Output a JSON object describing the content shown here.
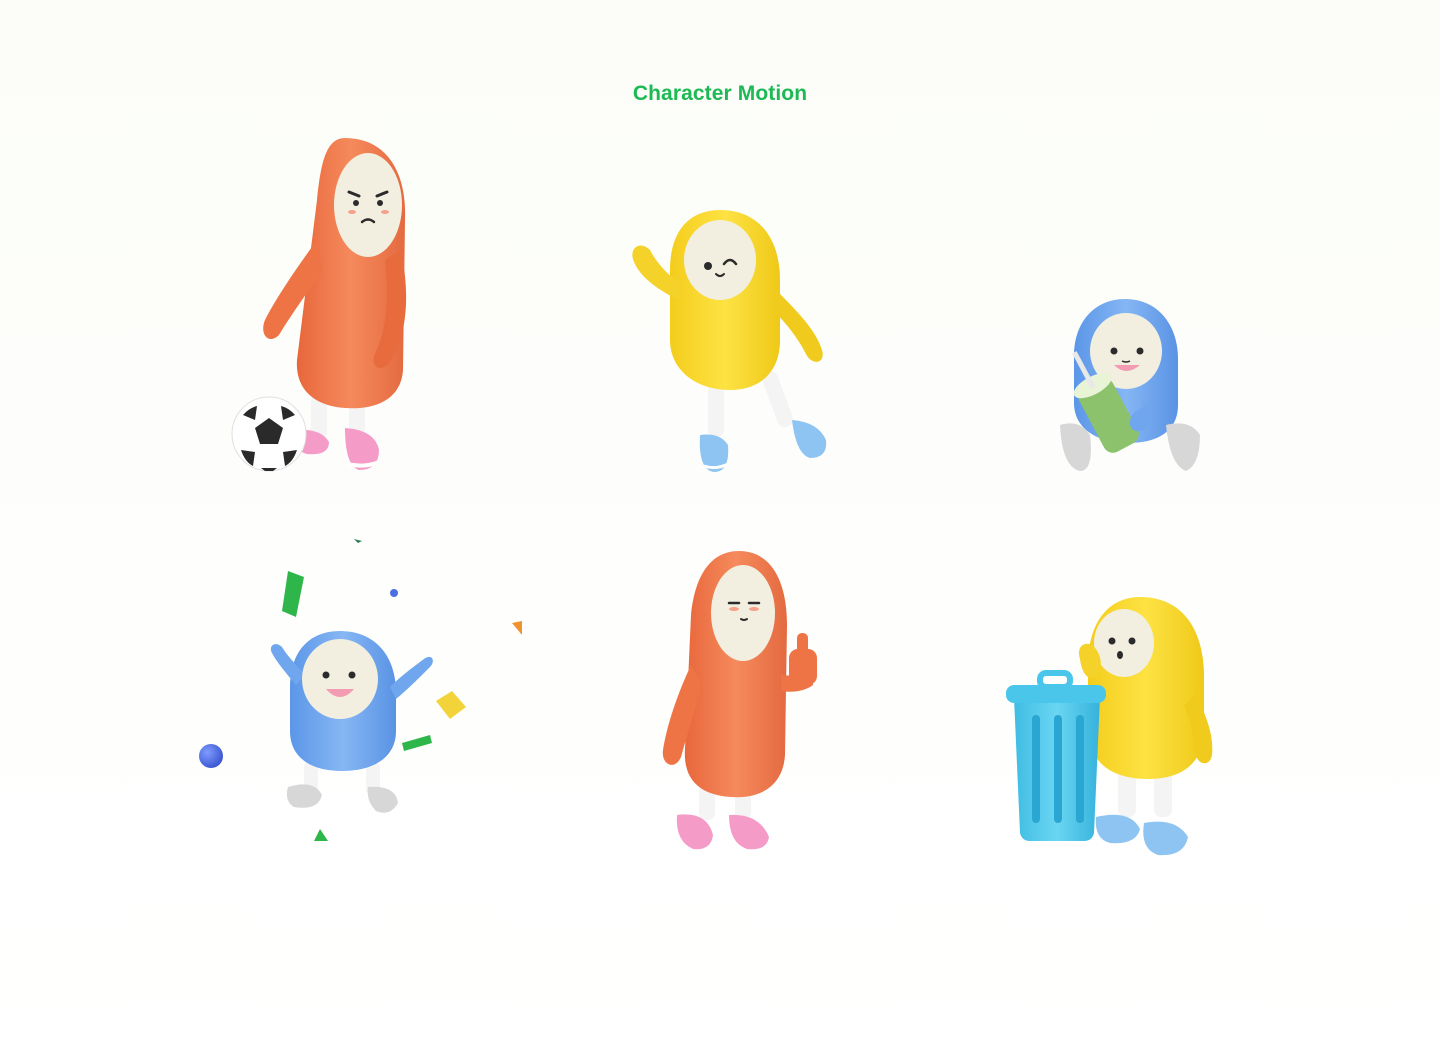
{
  "header": {
    "title": "Character Motion"
  },
  "colors": {
    "title": "#1db954",
    "orange": "#f07a4c",
    "yellow": "#f9d932",
    "blue": "#6fa6ee",
    "face": "#f3efe0",
    "pink_shoe": "#f49bc8",
    "blue_shoe": "#8ec4f2",
    "grey_shoe": "#d7d7d7",
    "trash_can": "#4fc9ea",
    "drink_cup": "#8cc26c",
    "confetti_green": "#2fb64a",
    "confetti_yellow": "#f2d43a",
    "confetti_orange": "#f0932e",
    "confetti_blue": "#4d6ee0"
  },
  "characters": [
    {
      "color": "orange",
      "pose": "soccer-ball",
      "expression": "angry"
    },
    {
      "color": "yellow",
      "pose": "waving",
      "expression": "wink"
    },
    {
      "color": "blue",
      "pose": "sitting-with-drink",
      "expression": "happy"
    },
    {
      "color": "blue",
      "pose": "jumping-confetti",
      "expression": "happy"
    },
    {
      "color": "orange",
      "pose": "thumbs-up",
      "expression": "calm"
    },
    {
      "color": "yellow",
      "pose": "trash-can",
      "expression": "surprised"
    }
  ]
}
